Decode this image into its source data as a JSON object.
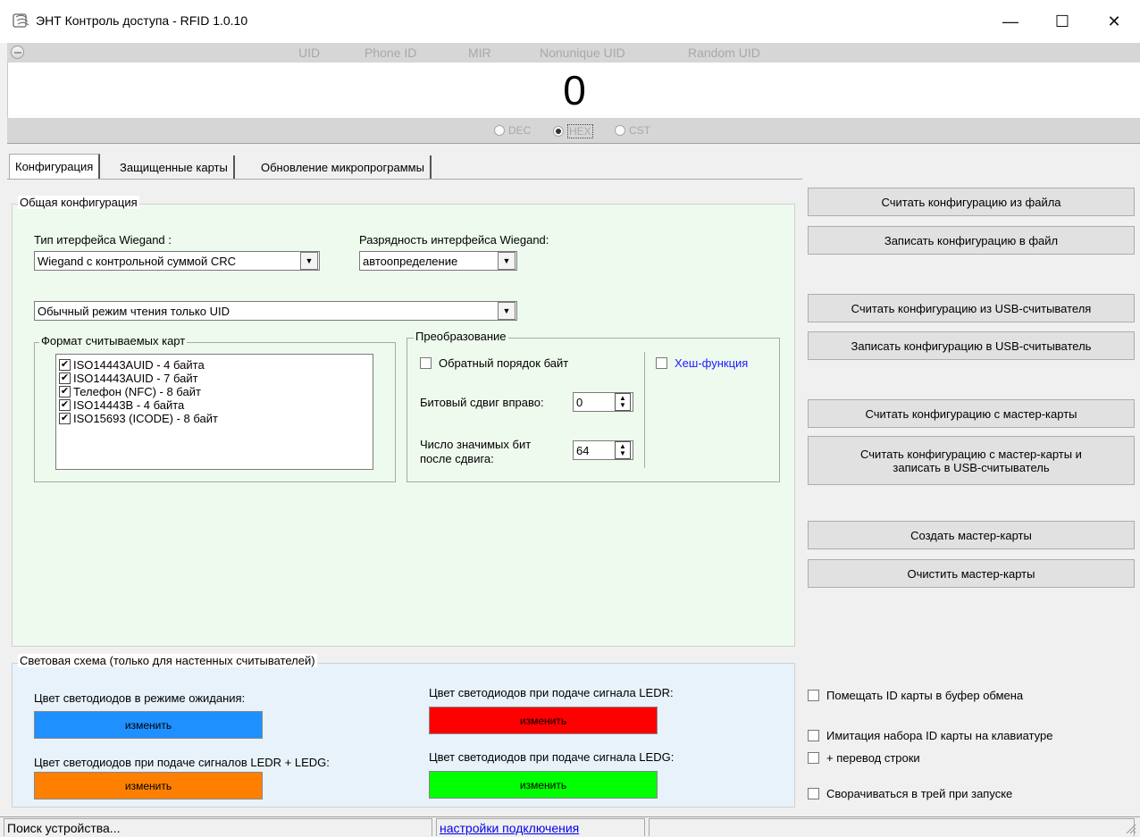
{
  "window": {
    "title": "ЭНТ Контроль доступа - RFID 1.0.10",
    "minimize": "—",
    "maximize": "☐",
    "close": "✕"
  },
  "id_types": [
    "UID",
    "Phone ID",
    "MIR",
    "Nonunique UID",
    "Random UID"
  ],
  "display": {
    "value": "0"
  },
  "formats": [
    {
      "label": "DEC",
      "selected": false
    },
    {
      "label": "HEX",
      "selected": true
    },
    {
      "label": "CST",
      "selected": false
    }
  ],
  "tabs": [
    "Конфигурация",
    "Защищенные карты",
    "Обновление микропрограммы"
  ],
  "general": {
    "title": "Общая конфигурация",
    "wiegand_type_label": "Тип итерфейса Wiegand :",
    "wiegand_type_value": "Wiegand с контрольной суммой CRC",
    "wiegand_bits_label": "Разрядность интерфейса Wiegand:",
    "wiegand_bits_value": "автоопределение",
    "read_mode_value": "Обычный режим чтения только UID",
    "card_formats_title": "Формат считываемых карт",
    "card_formats": [
      "ISO14443AUID - 4 байта",
      "ISO14443AUID - 7 байт",
      "Телефон (NFC) - 8 байт",
      "ISO14443B - 4 байта",
      "ISO15693 (ICODE) - 8 байт"
    ],
    "transform_title": "Преобразование",
    "reverse_bytes_label": "Обратный порядок байт",
    "hash_label": "Хеш-функция",
    "bit_shift_label": "Битовый сдвиг вправо:",
    "bit_shift_value": "0",
    "sig_bits_label_1": "Число значимых бит",
    "sig_bits_label_2": "после сдвига:",
    "sig_bits_value": "64"
  },
  "light": {
    "title": "Световая схема (только для настенных считывателей)",
    "idle_label": "Цвет светодиодов в режиме ожидания:",
    "ledr_label": "Цвет светодиодов при подаче сигнала LEDR:",
    "ledr_ledg_label": "Цвет светодиодов при подаче сигналов LEDR + LEDG:",
    "ledg_label": "Цвет светодиодов при подаче сигнала LEDG:",
    "change_label": "изменить",
    "idle_color": "#1e90ff",
    "ledr_color": "#ff0000",
    "ledr_ledg_color": "#ff8000",
    "ledg_color": "#00ff00"
  },
  "actions": [
    "Считать конфигурацию из файла",
    "Записать конфигурацию в файл",
    "Считать конфигурацию из USB-считывателя",
    "Записать конфигурацию в USB-считыватель",
    "Считать конфигурацию с мастер-карты",
    "Считать конфигурацию с мастер-карты и записать в USB-считыватель",
    "Создать мастер-карты",
    "Очистить мастер-карты"
  ],
  "options": [
    "Помещать ID карты в буфер обмена",
    "Имитация набора ID карты на клавиатуре",
    "+ перевод строки",
    "Сворачиваться в трей при запуске"
  ],
  "status": {
    "text": "Поиск устройства...",
    "link": "настройки подключения"
  },
  "colors": {
    "link": "#0000ee",
    "hash": "#1a1aff"
  }
}
